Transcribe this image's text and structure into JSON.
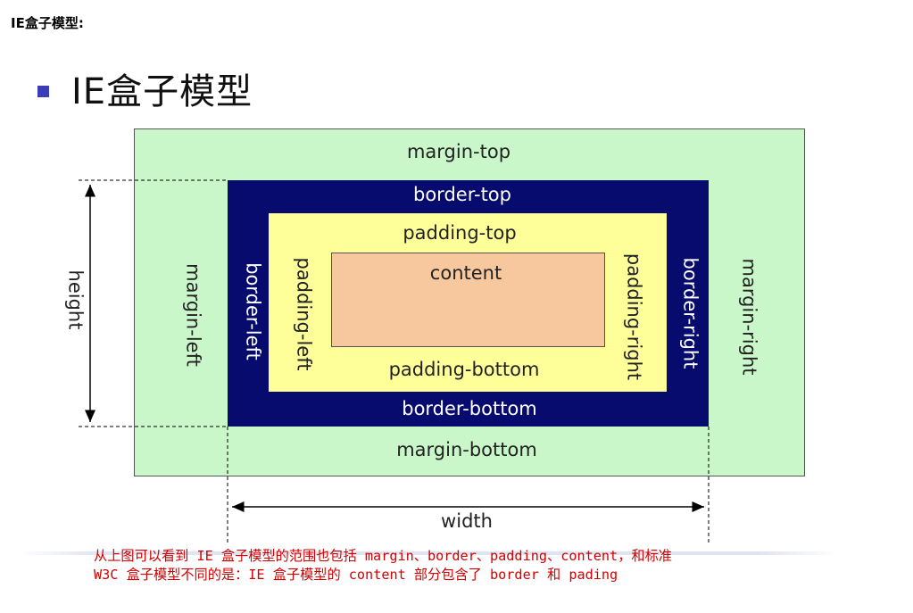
{
  "heading": "IE盒子模型:",
  "slide_title": "IE盒子模型",
  "diagram": {
    "margin_top": "margin-top",
    "margin_bottom": "margin-bottom",
    "margin_left": "margin-left",
    "margin_right": "margin-right",
    "border_top": "border-top",
    "border_bottom": "border-bottom",
    "border_left": "border-left",
    "border_right": "border-right",
    "padding_top": "padding-top",
    "padding_bottom": "padding-bottom",
    "padding_left": "padding-left",
    "padding_right": "padding-right",
    "content": "content",
    "height": "height",
    "width": "width"
  },
  "colors": {
    "margin": "#c9f7c9",
    "border": "#070b6e",
    "padding": "#ffff99",
    "content": "#f7c89e",
    "note": "#d40000"
  },
  "note": {
    "line1": "从上图可以看到 IE 盒子模型的范围也包括 margin、border、padding、content，和标准",
    "line2": "W3C 盒子模型不同的是：IE 盒子模型的 content 部分包含了 border 和 pading"
  }
}
